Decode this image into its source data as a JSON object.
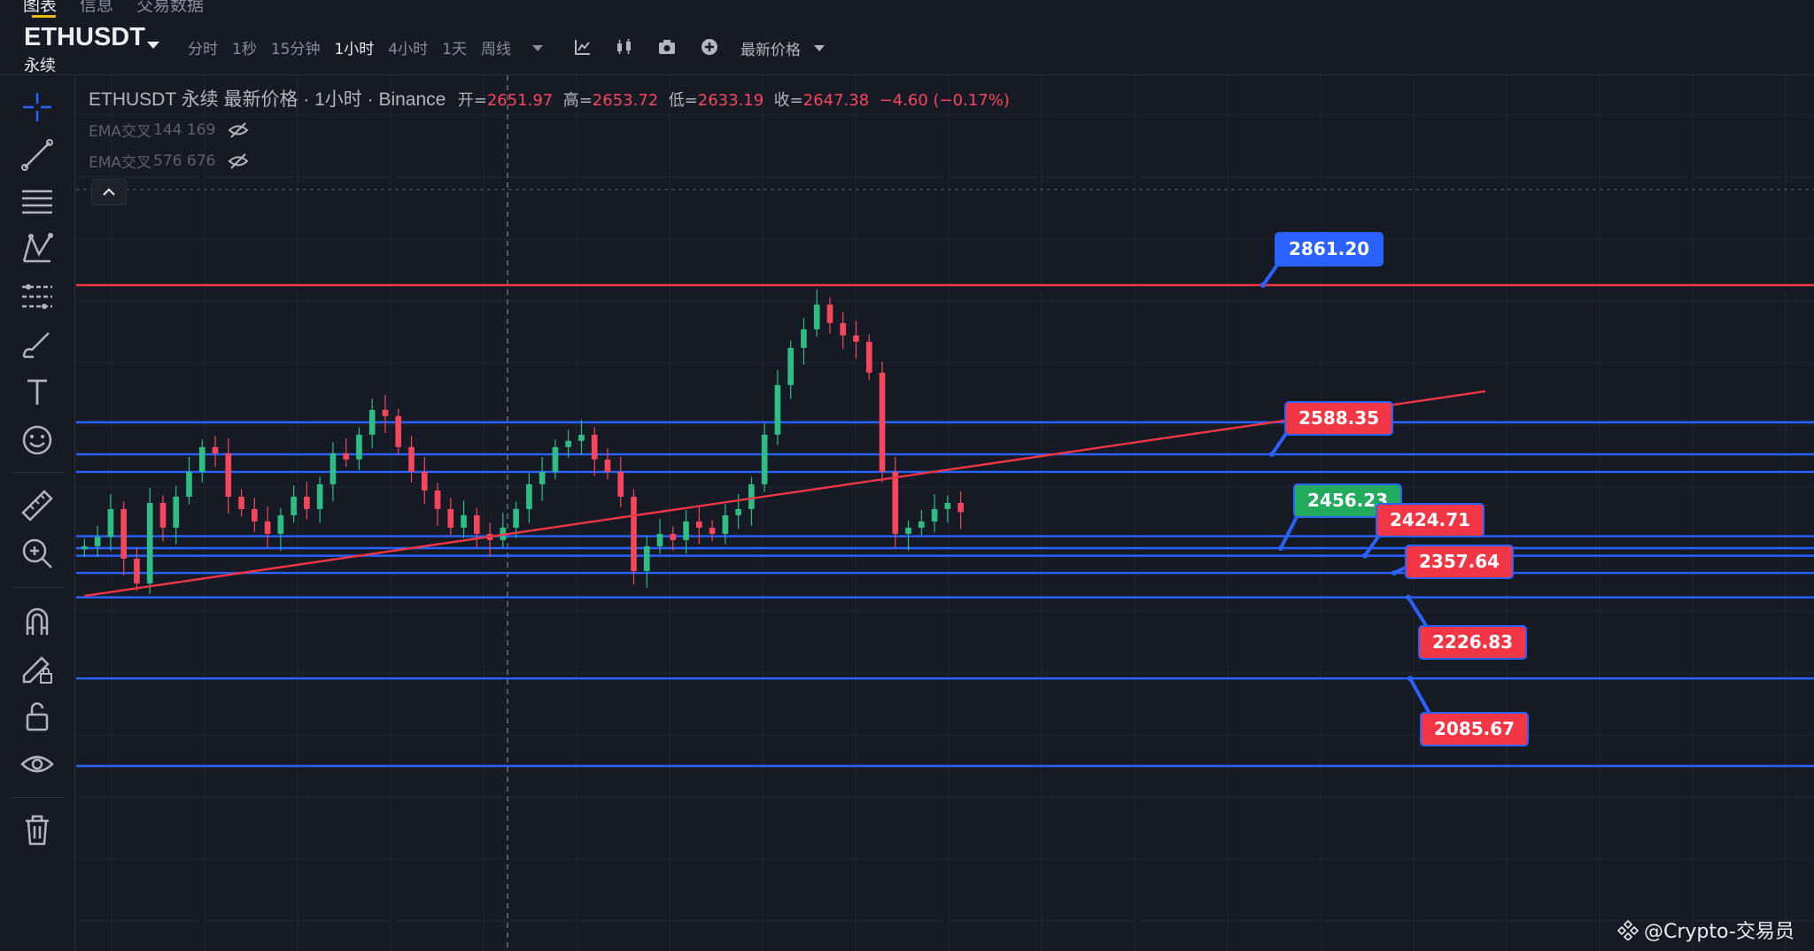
{
  "top_tabs": [
    "图表",
    "信息",
    "交易数据"
  ],
  "symbol": {
    "name": "ETHUSDT",
    "type": "永续"
  },
  "toolbar": {
    "intervals": [
      "分时",
      "1秒",
      "15分钟",
      "1小时",
      "4小时",
      "1天",
      "周线"
    ],
    "selected_interval": "1小时",
    "price_type": "最新价格",
    "icons": [
      "indicators-icon",
      "candle-style-icon",
      "camera-icon",
      "plus-circle-icon"
    ]
  },
  "legend": {
    "title": "ETHUSDT 永续 最新价格 · 1小时 · Binance",
    "open_label": "开=",
    "open": "2651.97",
    "high_label": "高=",
    "high": "2653.72",
    "low_label": "低=",
    "low": "2633.19",
    "close_label": "收=",
    "close": "2647.38",
    "change": "−4.60 (−0.17%)"
  },
  "indicators": [
    {
      "name": "EMA交叉",
      "params": "144 169"
    },
    {
      "name": "EMA交叉",
      "params": "576 676"
    }
  ],
  "left_tools": [
    "crosshair-icon",
    "trendline-icon",
    "fib-icon",
    "pattern-icon",
    "forecast-icon",
    "brush-icon",
    "text-icon",
    "emoji-icon",
    "ruler-icon",
    "zoom-in-icon",
    "magnet-icon",
    "lock-draw-icon",
    "unlock-icon",
    "eye-icon",
    "trash-icon"
  ],
  "price_tags": [
    {
      "value": "2861.20",
      "color": "blue"
    },
    {
      "value": "2588.35",
      "color": "red"
    },
    {
      "value": "2456.23",
      "color": "green"
    },
    {
      "value": "2424.71",
      "color": "red"
    },
    {
      "value": "2357.64",
      "color": "red"
    },
    {
      "value": "2226.83",
      "color": "red"
    },
    {
      "value": "2085.67",
      "color": "red"
    }
  ],
  "chart_data": {
    "type": "candlestick",
    "x": [
      0,
      1,
      2,
      3,
      4,
      5,
      6,
      7,
      8,
      9,
      10,
      11,
      12,
      13,
      14,
      15,
      16,
      17,
      18,
      19,
      20,
      21,
      22,
      23,
      24,
      25,
      26,
      27,
      28,
      29,
      30,
      31,
      32,
      33,
      34,
      35,
      36,
      37,
      38,
      39,
      40,
      41,
      42,
      43,
      44,
      45,
      46,
      47,
      48,
      49,
      50,
      51,
      52,
      53,
      54,
      55,
      56,
      57,
      58,
      59,
      60,
      61,
      62,
      63,
      64,
      65,
      66,
      67,
      68,
      69,
      70,
      71,
      72,
      73,
      74,
      75,
      76,
      77,
      78,
      79,
      80,
      81,
      82,
      83,
      84,
      85,
      86,
      87,
      88,
      89,
      90,
      91,
      92,
      93,
      94,
      95,
      96,
      97,
      98,
      99
    ],
    "close": [
      2440,
      2455,
      2500,
      2420,
      2380,
      2510,
      2470,
      2520,
      2560,
      2600,
      2590,
      2520,
      2500,
      2480,
      2460,
      2490,
      2520,
      2500,
      2540,
      2590,
      2580,
      2620,
      2660,
      2650,
      2600,
      2560,
      2530,
      2500,
      2470,
      2490,
      2460,
      2450,
      2470,
      2500,
      2540,
      2560,
      2600,
      2610,
      2620,
      2580,
      2560,
      2520,
      2400,
      2440,
      2460,
      2450,
      2480,
      2470,
      2460,
      2490,
      2500,
      2540,
      2620,
      2700,
      2760,
      2790,
      2830,
      2800,
      2780,
      2770,
      2720,
      2560,
      2460,
      2470,
      2480,
      2500,
      2510,
      2495
    ],
    "colors": {
      "up": "#2ebd85",
      "down": "#f6465d"
    },
    "horizontal_levels": [
      2861.2,
      2640,
      2588.35,
      2560,
      2456.23,
      2437,
      2424.71,
      2397,
      2357.64,
      2226.83,
      2085.67
    ],
    "level_colors": {
      "2861.20": "#f23645",
      "default": "#2962ff"
    },
    "trendline": {
      "from": [
        0,
        2360
      ],
      "to": [
        99,
        2660
      ],
      "color": "#f23645"
    }
  },
  "watermark": "@Crypto-交易员"
}
